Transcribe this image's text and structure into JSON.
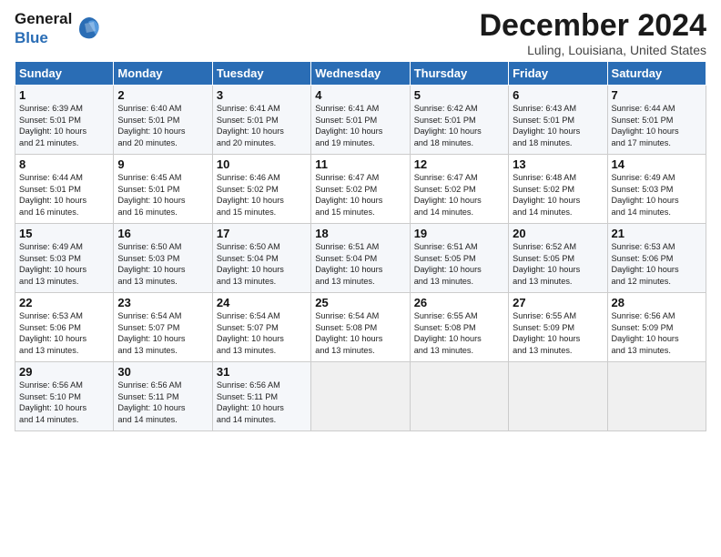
{
  "logo": {
    "general": "General",
    "blue": "Blue"
  },
  "title": "December 2024",
  "location": "Luling, Louisiana, United States",
  "weekdays": [
    "Sunday",
    "Monday",
    "Tuesday",
    "Wednesday",
    "Thursday",
    "Friday",
    "Saturday"
  ],
  "weeks": [
    [
      {
        "day": "1",
        "lines": [
          "Sunrise: 6:39 AM",
          "Sunset: 5:01 PM",
          "Daylight: 10 hours",
          "and 21 minutes."
        ]
      },
      {
        "day": "2",
        "lines": [
          "Sunrise: 6:40 AM",
          "Sunset: 5:01 PM",
          "Daylight: 10 hours",
          "and 20 minutes."
        ]
      },
      {
        "day": "3",
        "lines": [
          "Sunrise: 6:41 AM",
          "Sunset: 5:01 PM",
          "Daylight: 10 hours",
          "and 20 minutes."
        ]
      },
      {
        "day": "4",
        "lines": [
          "Sunrise: 6:41 AM",
          "Sunset: 5:01 PM",
          "Daylight: 10 hours",
          "and 19 minutes."
        ]
      },
      {
        "day": "5",
        "lines": [
          "Sunrise: 6:42 AM",
          "Sunset: 5:01 PM",
          "Daylight: 10 hours",
          "and 18 minutes."
        ]
      },
      {
        "day": "6",
        "lines": [
          "Sunrise: 6:43 AM",
          "Sunset: 5:01 PM",
          "Daylight: 10 hours",
          "and 18 minutes."
        ]
      },
      {
        "day": "7",
        "lines": [
          "Sunrise: 6:44 AM",
          "Sunset: 5:01 PM",
          "Daylight: 10 hours",
          "and 17 minutes."
        ]
      }
    ],
    [
      {
        "day": "8",
        "lines": [
          "Sunrise: 6:44 AM",
          "Sunset: 5:01 PM",
          "Daylight: 10 hours",
          "and 16 minutes."
        ]
      },
      {
        "day": "9",
        "lines": [
          "Sunrise: 6:45 AM",
          "Sunset: 5:01 PM",
          "Daylight: 10 hours",
          "and 16 minutes."
        ]
      },
      {
        "day": "10",
        "lines": [
          "Sunrise: 6:46 AM",
          "Sunset: 5:02 PM",
          "Daylight: 10 hours",
          "and 15 minutes."
        ]
      },
      {
        "day": "11",
        "lines": [
          "Sunrise: 6:47 AM",
          "Sunset: 5:02 PM",
          "Daylight: 10 hours",
          "and 15 minutes."
        ]
      },
      {
        "day": "12",
        "lines": [
          "Sunrise: 6:47 AM",
          "Sunset: 5:02 PM",
          "Daylight: 10 hours",
          "and 14 minutes."
        ]
      },
      {
        "day": "13",
        "lines": [
          "Sunrise: 6:48 AM",
          "Sunset: 5:02 PM",
          "Daylight: 10 hours",
          "and 14 minutes."
        ]
      },
      {
        "day": "14",
        "lines": [
          "Sunrise: 6:49 AM",
          "Sunset: 5:03 PM",
          "Daylight: 10 hours",
          "and 14 minutes."
        ]
      }
    ],
    [
      {
        "day": "15",
        "lines": [
          "Sunrise: 6:49 AM",
          "Sunset: 5:03 PM",
          "Daylight: 10 hours",
          "and 13 minutes."
        ]
      },
      {
        "day": "16",
        "lines": [
          "Sunrise: 6:50 AM",
          "Sunset: 5:03 PM",
          "Daylight: 10 hours",
          "and 13 minutes."
        ]
      },
      {
        "day": "17",
        "lines": [
          "Sunrise: 6:50 AM",
          "Sunset: 5:04 PM",
          "Daylight: 10 hours",
          "and 13 minutes."
        ]
      },
      {
        "day": "18",
        "lines": [
          "Sunrise: 6:51 AM",
          "Sunset: 5:04 PM",
          "Daylight: 10 hours",
          "and 13 minutes."
        ]
      },
      {
        "day": "19",
        "lines": [
          "Sunrise: 6:51 AM",
          "Sunset: 5:05 PM",
          "Daylight: 10 hours",
          "and 13 minutes."
        ]
      },
      {
        "day": "20",
        "lines": [
          "Sunrise: 6:52 AM",
          "Sunset: 5:05 PM",
          "Daylight: 10 hours",
          "and 13 minutes."
        ]
      },
      {
        "day": "21",
        "lines": [
          "Sunrise: 6:53 AM",
          "Sunset: 5:06 PM",
          "Daylight: 10 hours",
          "and 12 minutes."
        ]
      }
    ],
    [
      {
        "day": "22",
        "lines": [
          "Sunrise: 6:53 AM",
          "Sunset: 5:06 PM",
          "Daylight: 10 hours",
          "and 13 minutes."
        ]
      },
      {
        "day": "23",
        "lines": [
          "Sunrise: 6:54 AM",
          "Sunset: 5:07 PM",
          "Daylight: 10 hours",
          "and 13 minutes."
        ]
      },
      {
        "day": "24",
        "lines": [
          "Sunrise: 6:54 AM",
          "Sunset: 5:07 PM",
          "Daylight: 10 hours",
          "and 13 minutes."
        ]
      },
      {
        "day": "25",
        "lines": [
          "Sunrise: 6:54 AM",
          "Sunset: 5:08 PM",
          "Daylight: 10 hours",
          "and 13 minutes."
        ]
      },
      {
        "day": "26",
        "lines": [
          "Sunrise: 6:55 AM",
          "Sunset: 5:08 PM",
          "Daylight: 10 hours",
          "and 13 minutes."
        ]
      },
      {
        "day": "27",
        "lines": [
          "Sunrise: 6:55 AM",
          "Sunset: 5:09 PM",
          "Daylight: 10 hours",
          "and 13 minutes."
        ]
      },
      {
        "day": "28",
        "lines": [
          "Sunrise: 6:56 AM",
          "Sunset: 5:09 PM",
          "Daylight: 10 hours",
          "and 13 minutes."
        ]
      }
    ],
    [
      {
        "day": "29",
        "lines": [
          "Sunrise: 6:56 AM",
          "Sunset: 5:10 PM",
          "Daylight: 10 hours",
          "and 14 minutes."
        ]
      },
      {
        "day": "30",
        "lines": [
          "Sunrise: 6:56 AM",
          "Sunset: 5:11 PM",
          "Daylight: 10 hours",
          "and 14 minutes."
        ]
      },
      {
        "day": "31",
        "lines": [
          "Sunrise: 6:56 AM",
          "Sunset: 5:11 PM",
          "Daylight: 10 hours",
          "and 14 minutes."
        ]
      },
      {
        "day": "",
        "lines": []
      },
      {
        "day": "",
        "lines": []
      },
      {
        "day": "",
        "lines": []
      },
      {
        "day": "",
        "lines": []
      }
    ]
  ]
}
